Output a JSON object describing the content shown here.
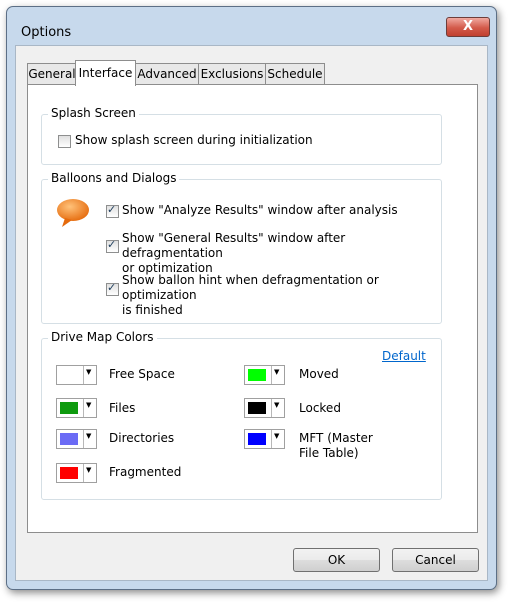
{
  "window": {
    "title": "Options",
    "close_symbol": "X"
  },
  "tabs": [
    {
      "label": "General",
      "active": false
    },
    {
      "label": "Interface",
      "active": true
    },
    {
      "label": "Advanced",
      "active": false
    },
    {
      "label": "Exclusions",
      "active": false
    },
    {
      "label": "Schedule",
      "active": false
    }
  ],
  "splash": {
    "title": "Splash Screen",
    "show_splash": {
      "label": "Show splash screen during initialization",
      "checked": false
    }
  },
  "balloons": {
    "title": "Balloons and Dialogs",
    "icon": "speech-balloon-icon",
    "icon_color": "#f07d1c",
    "options": [
      {
        "label_lines": [
          "Show \"Analyze Results\" window after analysis"
        ],
        "checked": true
      },
      {
        "label_lines": [
          "Show \"General Results\" window after defragmentation",
          "or optimization"
        ],
        "checked": true
      },
      {
        "label_lines": [
          "Show ballon hint when defragmentation or optimization",
          "is finished"
        ],
        "checked": true
      }
    ]
  },
  "colors": {
    "title": "Drive Map Colors",
    "default_link": "Default",
    "items": [
      {
        "label_lines": [
          "Free Space"
        ],
        "color": "#ffffff"
      },
      {
        "label_lines": [
          "Files"
        ],
        "color": "#0e9a0e"
      },
      {
        "label_lines": [
          "Directories"
        ],
        "color": "#6b6bf5"
      },
      {
        "label_lines": [
          "Fragmented"
        ],
        "color": "#ff0000"
      },
      {
        "label_lines": [
          "Moved"
        ],
        "color": "#00ff00"
      },
      {
        "label_lines": [
          "Locked"
        ],
        "color": "#000000"
      },
      {
        "label_lines": [
          "MFT (Master",
          "File Table)"
        ],
        "color": "#0000ff"
      }
    ]
  },
  "buttons": {
    "ok": "OK",
    "cancel": "Cancel"
  }
}
